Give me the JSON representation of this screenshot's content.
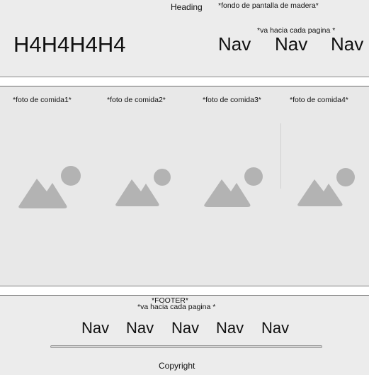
{
  "header": {
    "heading": "Heading",
    "wood_note": "*fondo de pantalla de madera*",
    "h4_text": "H4H4H4H4",
    "nav_note": "*va hacia cada pagina *",
    "nav": [
      "Nav",
      "Nav",
      "Nav"
    ]
  },
  "main": {
    "photos": [
      {
        "caption": "*foto de comida1*",
        "icon": "image-placeholder-icon"
      },
      {
        "caption": "*foto de comida2*",
        "icon": "image-placeholder-icon"
      },
      {
        "caption": "*foto de comida3*",
        "icon": "image-placeholder-icon"
      },
      {
        "caption": "*foto de comida4*",
        "icon": "image-placeholder-icon"
      }
    ]
  },
  "footer": {
    "title_note": "*FOOTER*",
    "nav_note": "*va hacia cada pagina *",
    "nav": [
      "Nav",
      "Nav",
      "Nav",
      "Nav",
      "Nav"
    ],
    "copyright": "Copyright"
  },
  "colors": {
    "panel": "#ececec",
    "main_bg": "#e8e8e8",
    "placeholder": "#b3b3b3"
  }
}
